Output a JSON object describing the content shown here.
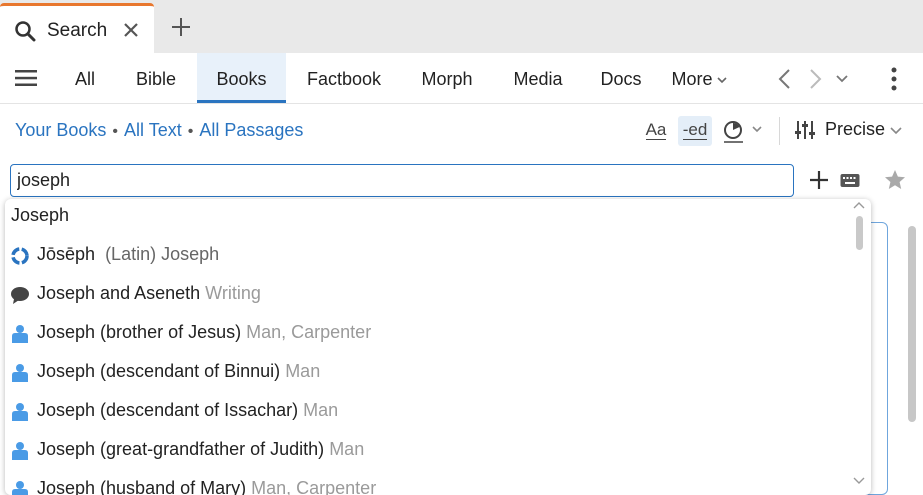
{
  "tab": {
    "title": "Search"
  },
  "nav": {
    "tabs": [
      "All",
      "Bible",
      "Books",
      "Factbook",
      "Morph",
      "Media",
      "Docs"
    ],
    "more_label": "More"
  },
  "filters": {
    "scope": "Your Books",
    "text": "All Text",
    "passages": "All Passages"
  },
  "options": {
    "case_label": "Aa",
    "ending_label": "-ed",
    "precision_label": "Precise"
  },
  "search": {
    "value": "joseph"
  },
  "suggestions": [
    {
      "main": "Joseph",
      "sub": "",
      "icon": "none"
    },
    {
      "main": "Jōsēph",
      "sub": "(Latin) Joseph",
      "icon": "lexicon-icon"
    },
    {
      "main": "Joseph and Aseneth",
      "sub": "Writing",
      "icon": "writing-icon"
    },
    {
      "main": "Joseph (brother of Jesus)",
      "sub": "Man, Carpenter",
      "icon": "person-icon"
    },
    {
      "main": "Joseph (descendant of Binnui)",
      "sub": "Man",
      "icon": "person-icon"
    },
    {
      "main": "Joseph (descendant of Issachar)",
      "sub": "Man",
      "icon": "person-icon"
    },
    {
      "main": "Joseph (great-grandfather of Judith)",
      "sub": "Man",
      "icon": "person-icon"
    },
    {
      "main": "Joseph (husband of Mary)",
      "sub": "Man, Carpenter",
      "icon": "person-icon"
    }
  ],
  "colors": {
    "accent": "#2a74c0",
    "tab_top": "#e8772e",
    "person_icon": "#4a9be6"
  }
}
